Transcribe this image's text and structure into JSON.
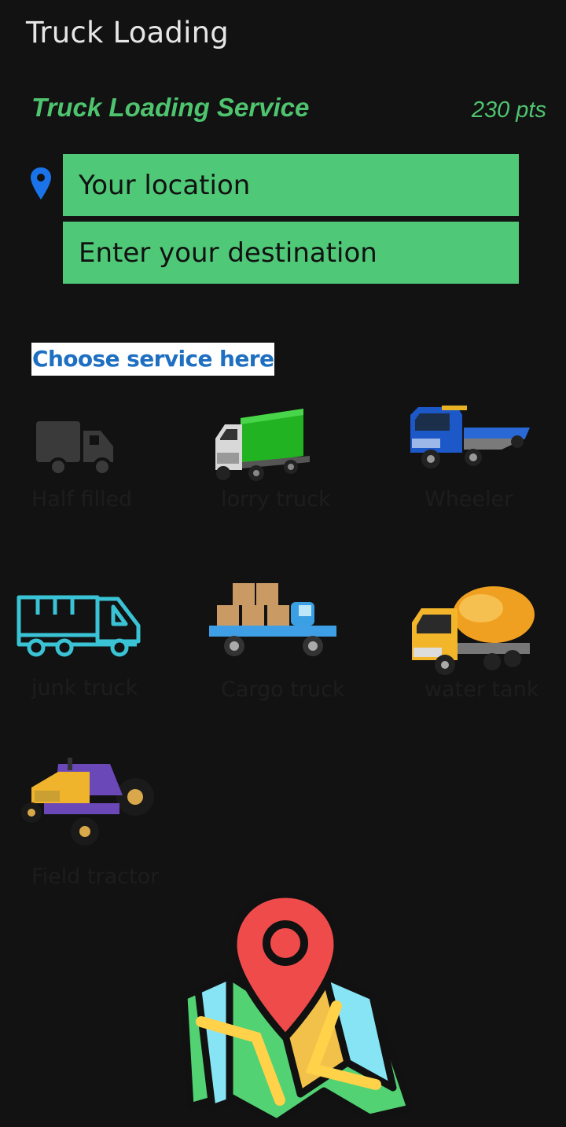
{
  "appbar": {
    "title": "Truck Loading"
  },
  "header": {
    "service_title": "Truck Loading Service",
    "points": "230 pts"
  },
  "location": {
    "placeholder": "Your location",
    "icon": "location-pin-icon"
  },
  "destination": {
    "placeholder": "Enter your destination"
  },
  "choose_label": "Choose service here",
  "services": [
    {
      "label": "Half filled",
      "icon": "half-filled-truck-icon"
    },
    {
      "label": "lorry truck",
      "icon": "lorry-truck-icon"
    },
    {
      "label": "Wheeler",
      "icon": "flatbed-wheeler-icon"
    },
    {
      "label": "junk truck",
      "icon": "junk-truck-icon"
    },
    {
      "label": "Cargo truck",
      "icon": "cargo-truck-icon"
    },
    {
      "label": "water tank",
      "icon": "mixer-tank-truck-icon"
    },
    {
      "label": "Field tractor",
      "icon": "tractor-icon"
    }
  ],
  "colors": {
    "accent": "#4fc46f",
    "field_bg": "#4fc877",
    "link": "#1e6fc2",
    "background": "#121212"
  }
}
